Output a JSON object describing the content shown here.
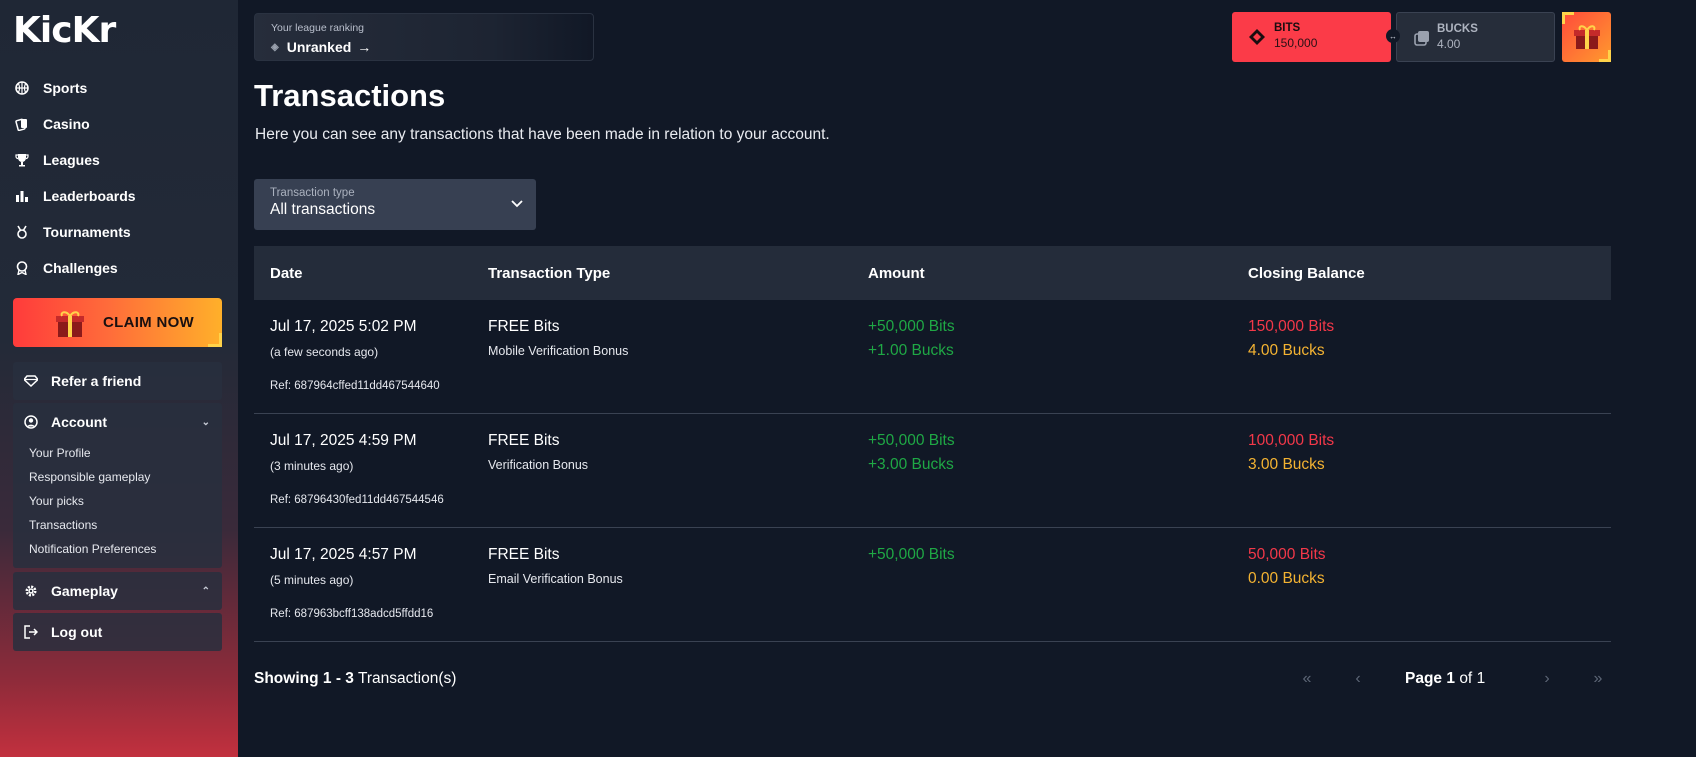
{
  "brand": {
    "logo": "KicKr"
  },
  "sidebar": {
    "nav": [
      {
        "label": "Sports",
        "icon": "basketball-icon"
      },
      {
        "label": "Casino",
        "icon": "cards-icon"
      },
      {
        "label": "Leagues",
        "icon": "trophy-icon"
      },
      {
        "label": "Leaderboards",
        "icon": "bar-chart-icon"
      },
      {
        "label": "Tournaments",
        "icon": "medal-icon"
      },
      {
        "label": "Challenges",
        "icon": "award-icon"
      }
    ],
    "claim_label": "CLAIM NOW",
    "refer_label": "Refer a friend",
    "account_label": "Account",
    "account_items": [
      "Your Profile",
      "Responsible gameplay",
      "Your picks",
      "Transactions",
      "Notification Preferences"
    ],
    "gameplay_label": "Gameplay",
    "logout_label": "Log out"
  },
  "header": {
    "ranking_label": "Your league ranking",
    "ranking_value": "Unranked",
    "bits_label": "BITS",
    "bits_value": "150,000",
    "bucks_label": "BUCKS",
    "bucks_value": "4.00"
  },
  "page": {
    "title": "Transactions",
    "description": "Here you can see any transactions that have been made in relation to your account."
  },
  "filter": {
    "label": "Transaction type",
    "value": "All transactions"
  },
  "table": {
    "headers": [
      "Date",
      "Transaction Type",
      "Amount",
      "Closing Balance"
    ],
    "rows": [
      {
        "date": "Jul 17, 2025 5:02 PM",
        "relative": "(a few seconds ago)",
        "ref": "Ref: 687964cffed11dd467544640",
        "type": "FREE Bits",
        "subtype": "Mobile Verification Bonus",
        "amount_bits": "+50,000 Bits",
        "amount_bucks": "+1.00 Bucks",
        "balance_bits": "150,000 Bits",
        "balance_bucks": "4.00 Bucks"
      },
      {
        "date": "Jul 17, 2025 4:59 PM",
        "relative": "(3 minutes ago)",
        "ref": "Ref: 68796430fed11dd467544546",
        "type": "FREE Bits",
        "subtype": "Verification Bonus",
        "amount_bits": "+50,000 Bits",
        "amount_bucks": "+3.00 Bucks",
        "balance_bits": "100,000 Bits",
        "balance_bucks": "3.00 Bucks"
      },
      {
        "date": "Jul 17, 2025 4:57 PM",
        "relative": "(5 minutes ago)",
        "ref": "Ref: 687963bcff138adcd5ffdd16",
        "type": "FREE Bits",
        "subtype": "Email Verification Bonus",
        "amount_bits": "+50,000 Bits",
        "amount_bucks": "",
        "balance_bits": "50,000 Bits",
        "balance_bucks": "0.00 Bucks"
      }
    ]
  },
  "footer": {
    "showing_prefix": "Showing",
    "showing_range": "1 - 3",
    "showing_suffix": "Transaction(s)",
    "page_word": "Page",
    "page_current": "1",
    "page_of": "of",
    "page_total": "1"
  },
  "colors": {
    "accent": "#fb3b48",
    "positive": "#1fa845",
    "balance_bits": "#f33849",
    "balance_bucks": "#f4b332"
  }
}
